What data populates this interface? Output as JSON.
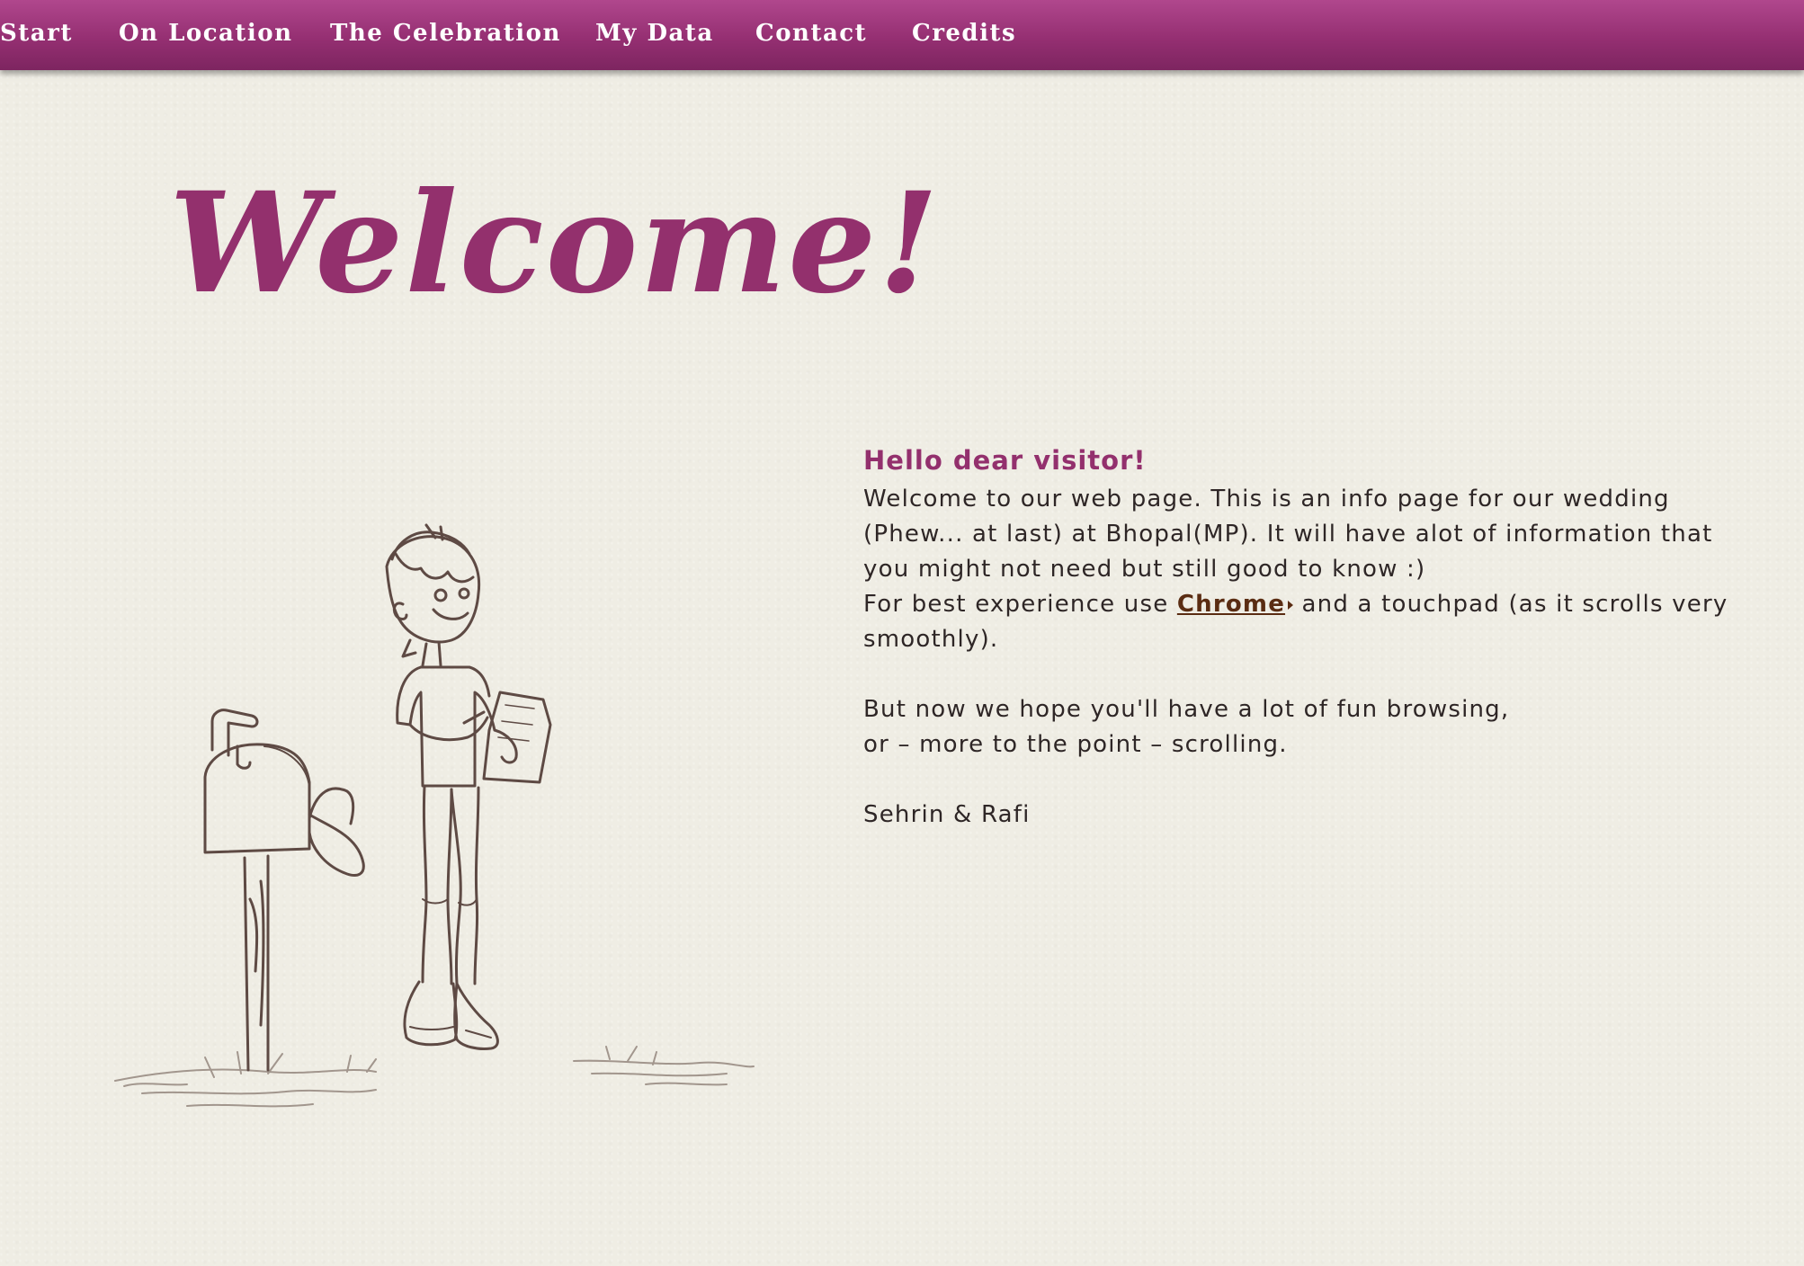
{
  "nav": {
    "items": [
      {
        "label": "Start"
      },
      {
        "label": "On Location"
      },
      {
        "label": "The Celebration"
      },
      {
        "label": "My Data"
      },
      {
        "label": "Contact"
      },
      {
        "label": "Credits"
      }
    ]
  },
  "hero": {
    "title": "Welcome!"
  },
  "main": {
    "greeting": "Hello dear visitor!",
    "intro": "Welcome to our web page. This is an info page for our wedding (Phew... at last) at Bhopal(MP). It will have alot of information that you might not need but still good to know :)",
    "browser_prefix": "For best experience use",
    "browser_link": "Chrome",
    "browser_suffix": "and a touchpad (as it scrolls very smoothly).",
    "hope_line1": "But now we hope you'll have a lot of fun browsing,",
    "hope_line2": "or – more to the point – scrolling.",
    "signature": "Sehrin & Rafi"
  },
  "colors": {
    "accent": "#93306d",
    "nav_top": "#b0478d",
    "nav_bottom": "#7d2560",
    "background": "#efede4",
    "text": "#2e2626",
    "link": "#5a2c12",
    "sketch": "#5e4a44"
  }
}
